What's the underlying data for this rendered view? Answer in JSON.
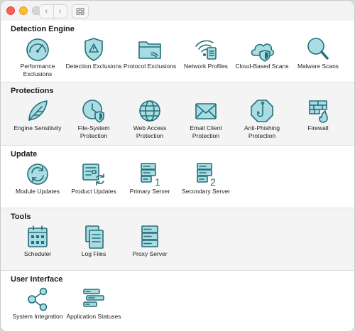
{
  "sections": [
    {
      "title": "Detection Engine",
      "items": [
        {
          "label": "Performance Exclusions",
          "icon": "gauge-icon"
        },
        {
          "label": "Detection Exclusions",
          "icon": "warning-shield-icon"
        },
        {
          "label": "Protocol Exclusions",
          "icon": "folder-icon"
        },
        {
          "label": "Network Profiles",
          "icon": "network-profile-icon"
        },
        {
          "label": "Cloud-Based Scans",
          "icon": "cloud-shield-icon"
        },
        {
          "label": "Malware Scans",
          "icon": "magnifier-icon"
        }
      ]
    },
    {
      "title": "Protections",
      "items": [
        {
          "label": "Engine Sensitivity",
          "icon": "feather-icon"
        },
        {
          "label": "File-System Protection",
          "icon": "clock-shield-icon"
        },
        {
          "label": "Web Access Protection",
          "icon": "globe-icon"
        },
        {
          "label": "Email Client Protection",
          "icon": "envelope-icon"
        },
        {
          "label": "Anti-Phishing Protection",
          "icon": "hook-octagon-icon"
        },
        {
          "label": "Firewall",
          "icon": "firewall-icon"
        }
      ]
    },
    {
      "title": "Update",
      "items": [
        {
          "label": "Module Updates",
          "icon": "refresh-icon"
        },
        {
          "label": "Product Updates",
          "icon": "product-update-icon"
        },
        {
          "label": "Primary Server",
          "icon": "server-1-icon"
        },
        {
          "label": "Secondary Server",
          "icon": "server-2-icon"
        }
      ]
    },
    {
      "title": "Tools",
      "items": [
        {
          "label": "Scheduler",
          "icon": "calendar-icon"
        },
        {
          "label": "Log Files",
          "icon": "log-files-icon"
        },
        {
          "label": "Proxy Server",
          "icon": "server-icon"
        }
      ]
    },
    {
      "title": "User Interface",
      "items": [
        {
          "label": "System Integration",
          "icon": "integration-icon"
        },
        {
          "label": "Application Statuses",
          "icon": "statuses-icon"
        }
      ]
    }
  ],
  "server_numbers": {
    "primary": "1",
    "secondary": "2"
  },
  "colors": {
    "icon_fill": "#a9dde3",
    "icon_stroke": "#266f7a",
    "alt_section": "#f4f4f4"
  }
}
